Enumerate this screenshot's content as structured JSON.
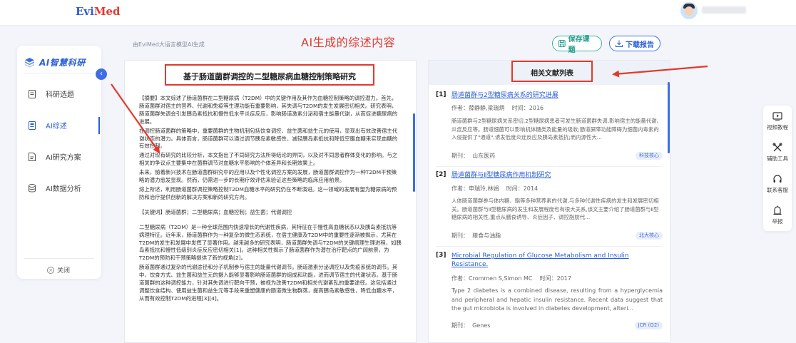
{
  "header": {
    "logo_part1": "Evi",
    "logo_part2": "Med"
  },
  "sidebar": {
    "brand": "AI智慧科研",
    "items": [
      {
        "label": "科研选题",
        "icon": "document-icon"
      },
      {
        "label": "AI综述",
        "icon": "doc-list-icon",
        "active": true
      },
      {
        "label": "AI研究方案",
        "icon": "file-plan-icon"
      },
      {
        "label": "AI数据分析",
        "icon": "database-icon"
      }
    ],
    "close_label": "关闭"
  },
  "toolbar": {
    "hint": "由EviMed大语言模型AI生成",
    "annotation": "AI生成的综述内容",
    "save_label": "保存课题",
    "download_label": "下载报告"
  },
  "article": {
    "title": "基于肠道菌群调控的二型糖尿病血糖控制策略研究",
    "paragraphs": [
      "【摘要】本文综述了肠道菌群在二型糖尿病（T2DM）中的关键作用及其作为血糖控制策略的调控潜力。首先，肠道菌群对宿主的营养、代谢和免疫等生理功能有重要影响，其失调与T2DM的发生发展密切相关。研究表明，肠道菌群失调会引发胰岛素抵抗和慢性低水平炎症反应，影响肠道激素分泌和宿主能量代谢，从而促进糖尿病的进展。",
      "在调控肠道菌群的策略中，重要菌群的生物机制包括饮食调控、益生菌和益生元的使用，显现出有效改善宿主代谢状态的潜力。具体而言，肠道菌群可以通过调节胰岛素敏感性、减轻胰岛素抵抗和降低空腹血糖来实现血糖的有效控制。",
      "通过对现有研究的比较分析，本文指出了不同研究方法所得结论的异同，以及对不同患者群体变化的影响。与之相关的争议点主要集中在菌群调节对血糖水平影响的个体差异和长期效果上。",
      "未来，随着新兴技术在肠道菌群研究中的应用以及个性化调控方案的发展，肠道菌群调控作为一种T2DM干预策略的潜力愈发显现。然而，仍需进一步的长期疗效评估来验证这些策略的临床应用前景。",
      "综上所述，利用肠道菌群调控策略控制T2DM血糖水平的研究仍在不断演进。这一领域的发展有望为糖尿病的预防和治疗提供创新的解决方案和新的研究方向。"
    ],
    "keywords": "【关键词】肠道菌群；二型糖尿病；血糖控制；益生菌；代谢调控",
    "body": [
      "二型糖尿病（T2DM）是一种全球范围内快速增长的代谢性疾病，其特征在于慢性高血糖状态以及胰岛素抵抗等病理特征。近年来，肠道菌群作为一种复杂的微生态系统，在宿主健康及T2DM中的重要性逐渐被揭示，尤其在T2DM的发生和发展中发挥了显著作用。越来越多的研究表明，肠道菌群失调与T2DM的关键病理生理进程，如胰岛素抵抗和慢性低级别炎症反应密切相关[1]。这种相关性揭示了肠道菌群作为潜在治疗靶点的广阔前景，为T2DM的预防和干预策略提供了新的视角[2]。",
      "肠道菌群通过复杂的代谢途径和分子机制参与宿主的能量代谢调节。肠道激素分泌调控以及免疫系统的调节。其中，饮食方式、益生菌和益生元的摄入能够显著影响肠道菌群的组成和功能，进而调节宿主的代谢状态。基于肠道菌群的这种调控能力，针对其失调进行靶向干预，被视为改善T2DM和相关代谢紊乱的重要途径。这包括通过调整饮食结构、使用益生菌和益生元等手段来重塑健康的肠道微生物群落，提高胰岛素敏感性，降低血糖水平，从而有效控制T2DM的进程[3][4]。"
    ]
  },
  "references": {
    "title": "相关文献列表",
    "items": [
      {
        "index": "[1]",
        "title": "肠道菌群与2型糖尿病关系的研究进展",
        "authors_label": "作者：",
        "authors": "薛静静,梁瑞炳",
        "time_label": "时间：",
        "time": "2016",
        "abstract": "肠道菌群与2型糖尿病关系密切,2型糖尿病患者可发生肠道菌群失调,影响宿主的能量代谢、炎症反应等。肠道细菌可以影响机体糖类及能量的吸收;肠道屏障功能障碍为细菌内毒素的入侵提供了\"通道\",诱发低度炎症反应及胰岛素抵抗;而内源性大...",
        "journal_label": "期刊：",
        "journal": "山东医药",
        "tag": "科技核心"
      },
      {
        "index": "[2]",
        "title": "肠道菌群与Ⅱ型糖尿病作用机制研究",
        "authors_label": "作者：",
        "authors": "申瑞玲,林娟",
        "time_label": "时间：",
        "time": "2014",
        "abstract": "人体肠道菌群参与体内糖、脂等多种营养素的代谢,与多种代谢性疾病的发生和发展密切相关。肠道菌群与Ⅱ型糖尿病的发生和发展程度也有很大关系,该文主要介绍了肠道菌群与Ⅱ型糖尿病的相关性,重点从膳食诱导、炎症因子、调控脂肪代...",
        "journal_label": "期刊：",
        "journal": "粮食与油脂",
        "tag": "北大核心"
      },
      {
        "index": "[3]",
        "title": "Microbial Regulation of Glucose Metabolism and Insulin Resistance.",
        "authors_label": "作者：",
        "authors": "Crommen S,Simon MC",
        "time_label": "时间：",
        "time": "2017",
        "abstract": "Type 2 diabetes is a combined disease, resulting from a hyperglycemia and peripheral and hepatic insulin resistance. Recent data suggest that the gut microbiota is involved in diabetes development, alteri...",
        "journal_label": "期刊：",
        "journal": "Genes",
        "tag": "JCR (Q2)"
      }
    ]
  },
  "rail": {
    "items": [
      {
        "label": "视频教程",
        "icon": "video-icon"
      },
      {
        "label": "辅助工具",
        "icon": "tools-icon"
      },
      {
        "label": "联系客服",
        "icon": "headset-icon"
      },
      {
        "label": "举报",
        "icon": "report-icon"
      }
    ]
  },
  "colors": {
    "brand_blue": "#2b5fd9",
    "annotation_red": "#e23a2c",
    "save_green": "#1f9d87"
  }
}
